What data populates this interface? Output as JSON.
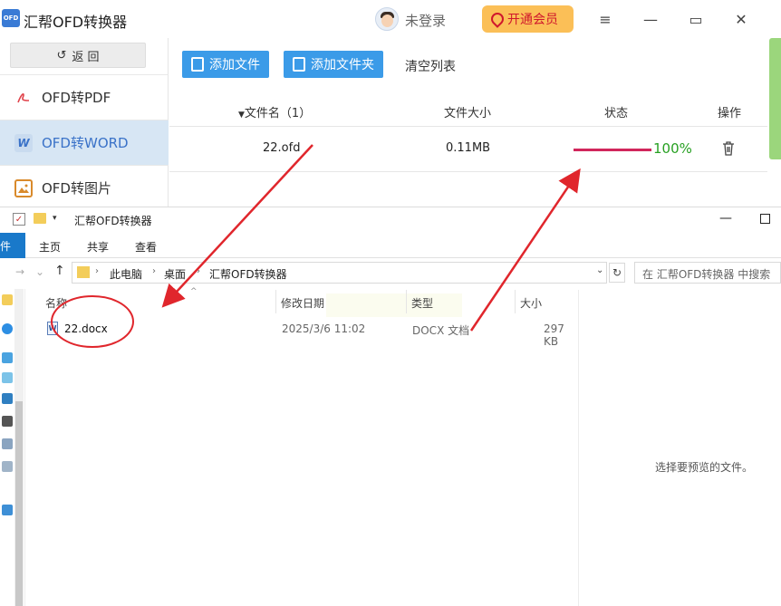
{
  "app": {
    "logo_text": "OFD",
    "title": "汇帮OFD转换器",
    "login_text": "未登录",
    "vip_label": "开通会员",
    "window_controls": {
      "menu": "≡",
      "minimize": "—",
      "maximize": "▭",
      "close": "✕"
    }
  },
  "sidebar": {
    "back_label": "返 回",
    "back_icon": "↺",
    "items": [
      {
        "label": "OFD转PDF",
        "icon": "pdf-icon",
        "active": false
      },
      {
        "label": "OFD转WORD",
        "icon": "word-icon",
        "active": true
      },
      {
        "label": "OFD转图片",
        "icon": "image-icon",
        "active": false
      }
    ]
  },
  "toolbar": {
    "add_file": "添加文件",
    "add_folder": "添加文件夹",
    "clear_list": "清空列表"
  },
  "table": {
    "headers": {
      "name": "文件名（1）",
      "size": "文件大小",
      "status": "状态",
      "action": "操作"
    },
    "rows": [
      {
        "name": "22.ofd",
        "size": "0.11MB",
        "progress": 1.0,
        "progress_text": "100%"
      }
    ]
  },
  "explorer": {
    "title": "汇帮OFD转换器",
    "ribbon": {
      "file": "件",
      "home": "主页",
      "share": "共享",
      "view": "查看"
    },
    "breadcrumb": [
      "此电脑",
      "桌面",
      "汇帮OFD转换器"
    ],
    "search_placeholder": "在 汇帮OFD转换器 中搜索",
    "columns": {
      "name": "名称",
      "date": "修改日期",
      "type": "类型",
      "size": "大小"
    },
    "files": [
      {
        "name": "22.docx",
        "date": "2025/3/6 11:02",
        "type": "DOCX 文档",
        "size": "297 KB"
      }
    ],
    "preview_text": "选择要预览的文件。"
  },
  "colors": {
    "accent_blue": "#3b9be8",
    "active_side_bg": "#d7e6f4",
    "progress": "#d1265c",
    "done_green": "#27a022",
    "vip_bg": "#fbbf57",
    "annotation_red": "#e0262c"
  }
}
